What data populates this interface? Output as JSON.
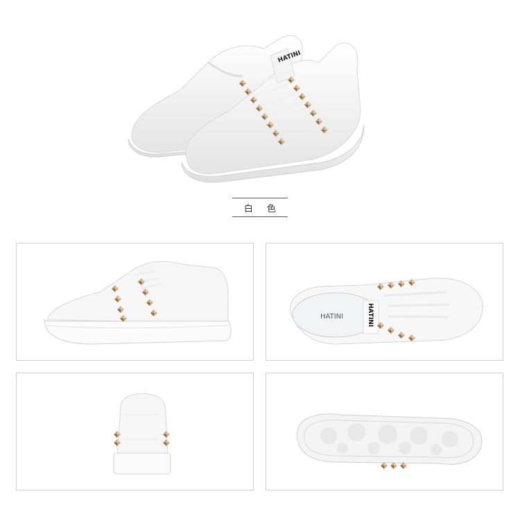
{
  "color_label": "白 色",
  "brand": {
    "tongue_text": "HATINI",
    "insole_text": "HATINI"
  },
  "colors": {
    "shoe": "#f7f7f7",
    "shoe_shade": "#e6e6e6",
    "stud": "#c9a47a",
    "stud_dark": "#8c6a45",
    "panel_border": "#cfcfcf"
  },
  "views": [
    "front-pair",
    "side",
    "top",
    "back",
    "sole"
  ]
}
